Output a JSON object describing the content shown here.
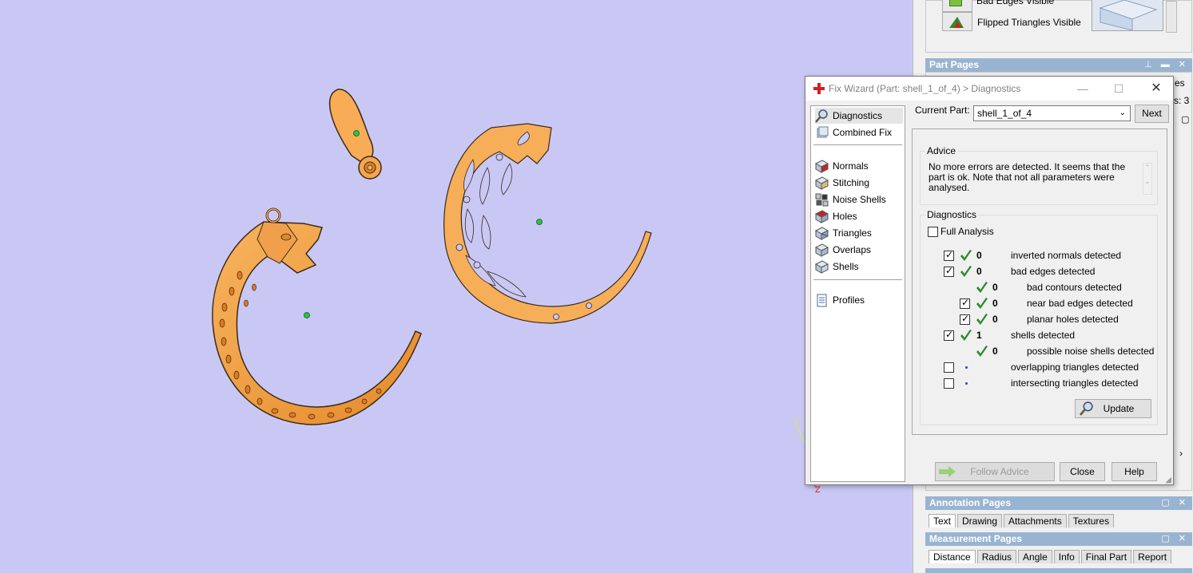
{
  "viewport": {
    "axis_y": "Y",
    "axis_z": "Z",
    "model_color": "#f5a850",
    "background": "#c9c8f5"
  },
  "dock": {
    "bad_edges_label": "Bad Edges Visible",
    "flipped_label": "Flipped Triangles Visible",
    "part_pages": {
      "title": "Part Pages",
      "partial_tab": "es",
      "count_text": "s: 3"
    },
    "annotation_pages": {
      "title": "Annotation Pages",
      "tabs": [
        "Text",
        "Drawing",
        "Attachments",
        "Textures"
      ]
    },
    "measurement_pages": {
      "title": "Measurement Pages",
      "tabs": [
        "Distance",
        "Radius",
        "Angle",
        "Info",
        "Final Part",
        "Report"
      ]
    }
  },
  "dialog": {
    "title": "Fix Wizard (Part: shell_1_of_4) > Diagnostics",
    "nav": {
      "items_top": [
        "Diagnostics",
        "Combined Fix"
      ],
      "items_mid": [
        "Normals",
        "Stitching",
        "Noise Shells",
        "Holes",
        "Triangles",
        "Overlaps",
        "Shells"
      ],
      "items_bottom": [
        "Profiles"
      ]
    },
    "current_part_label": "Current Part:",
    "current_part_value": "shell_1_of_4",
    "next_button": "Next",
    "advice": {
      "title": "Advice",
      "text": "No more errors are detected. It seems that the part is ok. Note that not all parameters were analysed."
    },
    "diagnostics": {
      "title": "Diagnostics",
      "full_analysis": "Full Analysis",
      "rows": [
        {
          "checked": true,
          "status": "ok",
          "count": "0",
          "label": "inverted normals detected",
          "indent": 0
        },
        {
          "checked": true,
          "status": "ok",
          "count": "0",
          "label": "bad edges detected",
          "indent": 0
        },
        {
          "checked": null,
          "status": "ok",
          "count": "0",
          "label": "bad contours detected",
          "indent": 1
        },
        {
          "checked": true,
          "status": "ok",
          "count": "0",
          "label": "near bad edges detected",
          "indent": 1
        },
        {
          "checked": true,
          "status": "ok",
          "count": "0",
          "label": "planar holes detected",
          "indent": 1
        },
        {
          "checked": true,
          "status": "ok",
          "count": "1",
          "label": "shells detected",
          "indent": 0
        },
        {
          "checked": null,
          "status": "ok",
          "count": "0",
          "label": "possible noise shells detected",
          "indent": 1
        },
        {
          "checked": false,
          "status": "unknown",
          "count": "",
          "label": "overlapping triangles detected",
          "indent": 0
        },
        {
          "checked": false,
          "status": "unknown",
          "count": "",
          "label": "intersecting triangles detected",
          "indent": 0
        }
      ],
      "update_button": "Update"
    },
    "follow_advice_button": "Follow Advice",
    "close_button": "Close",
    "help_button": "Help"
  }
}
